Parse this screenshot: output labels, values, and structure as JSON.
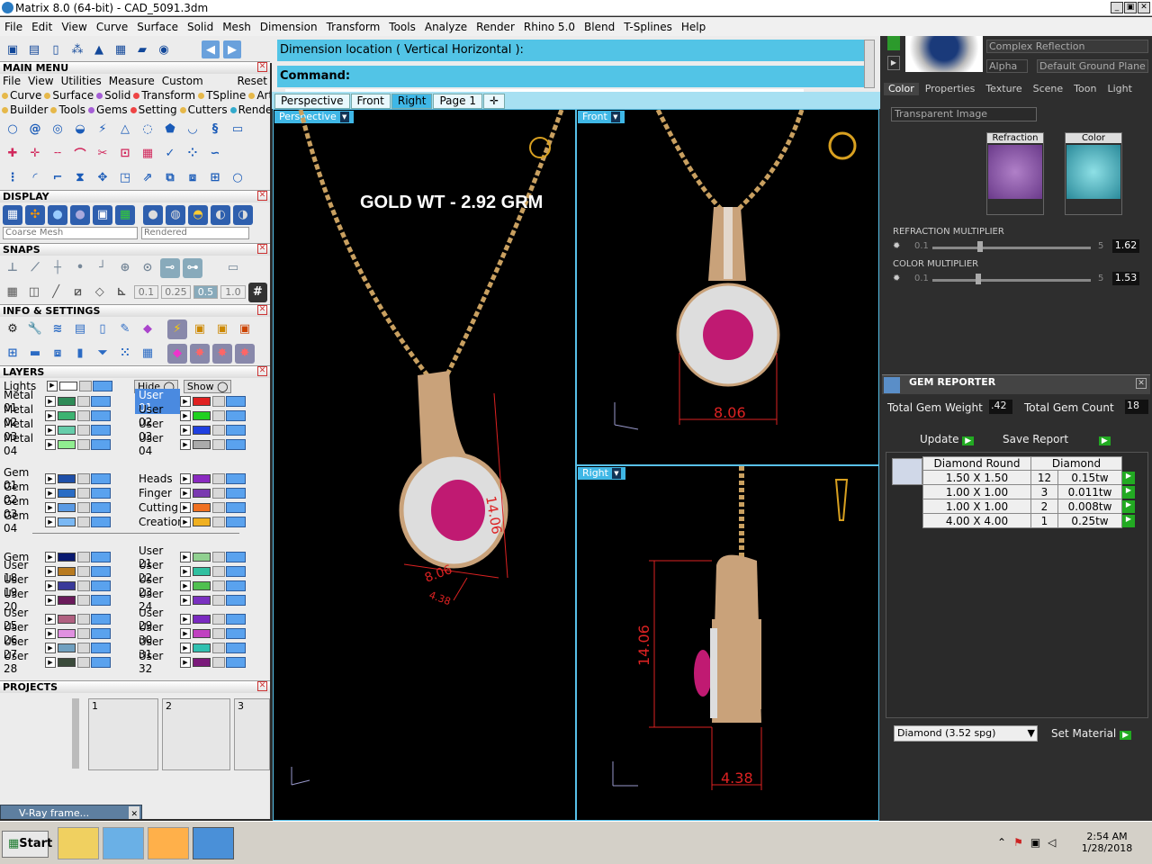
{
  "title": "Matrix 8.0 (64-bit) - CAD_5091.3dm",
  "menu": [
    "File",
    "Edit",
    "View",
    "Curve",
    "Surface",
    "Solid",
    "Mesh",
    "Dimension",
    "Transform",
    "Tools",
    "Analyze",
    "Render",
    "Rhino 5.0",
    "Blend",
    "T-Splines",
    "Help"
  ],
  "left": {
    "main_menu": "MAIN MENU",
    "main_menu_items": [
      "File",
      "View",
      "Utilities",
      "Measure",
      "Custom",
      "Reset"
    ],
    "cat_row1": [
      "Curve",
      "Surface",
      "Solid",
      "Transform",
      "TSpline",
      "Art"
    ],
    "cat_row2": [
      "Builder",
      "Tools",
      "Gems",
      "Setting",
      "Cutters",
      "Render"
    ],
    "display": "DISPLAY",
    "display_mesh": "Coarse Mesh",
    "display_mode": "Rendered",
    "snaps": "SNAPS",
    "snap_values": [
      "0.1",
      "0.25",
      "0.5",
      "1.0"
    ],
    "info": "INFO & SETTINGS",
    "layers": "LAYERS",
    "lights": "Lights",
    "hide": "Hide",
    "show": "Show",
    "layers_left": [
      "Metal 01",
      "Metal 02",
      "Metal 03",
      "Metal 04",
      "Gem 01",
      "Gem 02",
      "Gem 03",
      "Gem 04",
      "Gem",
      "User 18",
      "User 19",
      "User 20",
      "User 25",
      "User 26",
      "User 27",
      "User 28"
    ],
    "layers_right": [
      "User 01",
      "User 02",
      "User 03",
      "User 04",
      "Heads",
      "Finger",
      "Cutting",
      "Creation",
      "User 21",
      "User 22",
      "User 23",
      "User 24",
      "User 29",
      "User 30",
      "User 31",
      "User 32"
    ],
    "projects": "PROJECTS",
    "project_slots": [
      "1",
      "2",
      "3"
    ],
    "vray_frame": "V-Ray frame..."
  },
  "cmd": {
    "prompt1": "Dimension location ( Vertical  Horizontal ):",
    "prompt2": "Command:"
  },
  "tabs": [
    "Perspective",
    "Front",
    "Right",
    "Page 1"
  ],
  "viewports": {
    "persp": "Perspective",
    "front": "Front",
    "right": "Right",
    "gold_label": "GOLD WT - 2.92 GRM",
    "dim_806": "8.06",
    "dim_1406": "14.06",
    "dim_438": "4.38"
  },
  "right": {
    "reflection": "Complex Reflection",
    "alpha": "Alpha",
    "ground": "Default Ground Plane",
    "tabs": [
      "Color",
      "Properties",
      "Texture",
      "Scene",
      "Toon",
      "Light"
    ],
    "transparent": "Transparent Image",
    "refraction": "Refraction",
    "color": "Color",
    "refr_mult_label": "REFRACTION MULTIPLIER",
    "refr_min": "0.1",
    "refr_max": "5",
    "refr_val": "1.62",
    "color_mult_label": "COLOR MULTIPLIER",
    "col_min": "0.1",
    "col_max": "5",
    "col_val": "1.53",
    "gem_reporter": "GEM REPORTER",
    "total_weight_label": "Total Gem Weight",
    "total_weight": ".42",
    "total_count_label": "Total Gem Count",
    "total_count": "18",
    "update": "Update",
    "save_report": "Save Report",
    "gem_headers": [
      "Diamond Round",
      "Diamond"
    ],
    "gem_rows": [
      [
        "1.50 X 1.50",
        "12",
        "0.15tw"
      ],
      [
        "1.00 X 1.00",
        "3",
        "0.011tw"
      ],
      [
        "1.00 X 1.00",
        "2",
        "0.008tw"
      ],
      [
        "4.00 X 4.00",
        "1",
        "0.25tw"
      ]
    ],
    "material": "Diamond    (3.52 spg)",
    "set_material": "Set Material"
  },
  "taskbar": {
    "start": "Start",
    "time": "2:54 AM",
    "date": "1/28/2018"
  }
}
